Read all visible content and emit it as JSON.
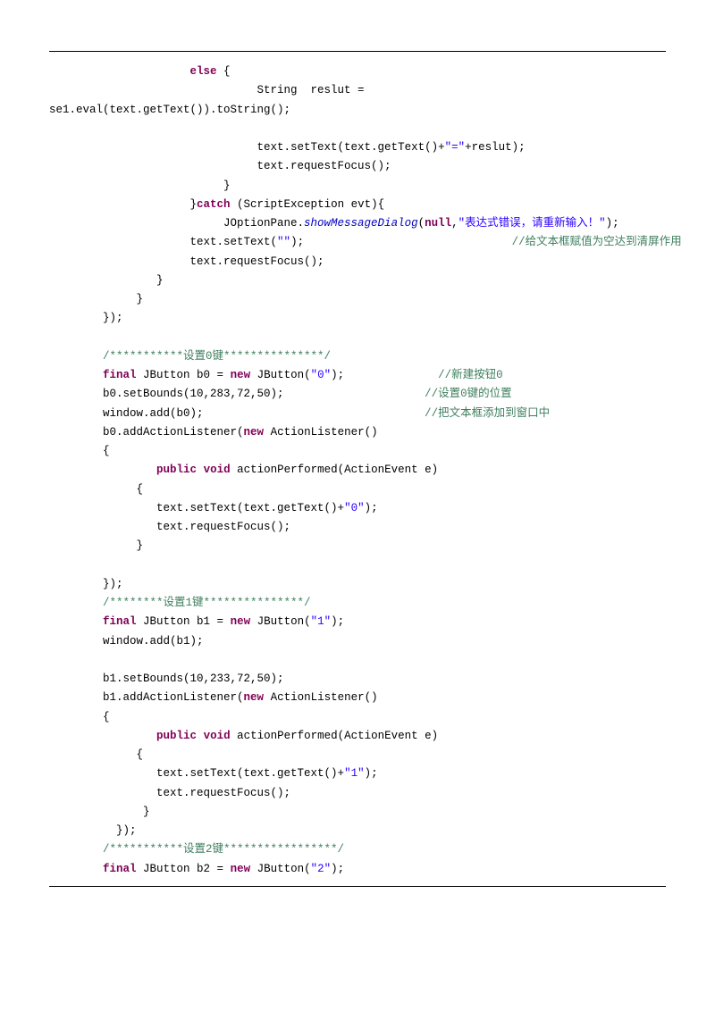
{
  "code": {
    "l01a": "else",
    "l01b": " {",
    "l02a": "                               String  reslut = ",
    "l03a": "se1.eval(text.getText()).toString();",
    "l04a": "                               text.setText(text.getText()+",
    "l04b": "\"=\"",
    "l04c": "+reslut);",
    "l05a": "                               text.requestFocus();",
    "l06a": "                          }",
    "l07a": "                     }",
    "l07b": "catch",
    "l07c": " (ScriptException evt){",
    "l08a": "                          JOptionPane.",
    "l08b": "showMessageDialog",
    "l08c": "(",
    "l08d": "null",
    "l08e": ",",
    "l08f": "\"表达式错误，请重新输入！\"",
    "l08g": ");",
    "l09a": "                     text.setText(",
    "l09b": "\"\"",
    "l09c": ");                               ",
    "l09d": "//给文本框赋值为空达到清屏作用",
    "l10a": "                     text.requestFocus();",
    "l11a": "                }",
    "l12a": "             }",
    "l13a": "        });",
    "l14a": "        ",
    "l14b": "/***********设置0键***************/",
    "l15a": "        ",
    "l15b": "final",
    "l15c": " JButton b0 = ",
    "l15d": "new",
    "l15e": " JButton(",
    "l15f": "\"0\"",
    "l15g": ");              ",
    "l15h": "//新建按钮0",
    "l16a": "        b0.setBounds(10,283,72,50);                     ",
    "l16b": "//设置0键的位置",
    "l17a": "        window.add(b0);                                 ",
    "l17b": "//把文本框添加到窗口中",
    "l18a": "        b0.addActionListener(",
    "l18b": "new",
    "l18c": " ActionListener()",
    "l19a": "        {",
    "l20a": "                ",
    "l20b": "public",
    "l20c": " ",
    "l20d": "void",
    "l20e": " actionPerformed(ActionEvent e)",
    "l21a": "             {",
    "l22a": "                text.setText(text.getText()+",
    "l22b": "\"0\"",
    "l22c": ");",
    "l23a": "                text.requestFocus();",
    "l24a": "             }",
    "l25a": "        });",
    "l26a": "        ",
    "l26b": "/********设置1键***************/",
    "l27a": "        ",
    "l27b": "final",
    "l27c": " JButton b1 = ",
    "l27d": "new",
    "l27e": " JButton(",
    "l27f": "\"1\"",
    "l27g": ");",
    "l28a": "        window.add(b1);",
    "l29a": "        b1.setBounds(10,233,72,50);",
    "l30a": "        b1.addActionListener(",
    "l30b": "new",
    "l30c": " ActionListener()",
    "l31a": "        {",
    "l32a": "                ",
    "l32b": "public",
    "l32c": " ",
    "l32d": "void",
    "l32e": " actionPerformed(ActionEvent e)",
    "l33a": "             {",
    "l34a": "                text.setText(text.getText()+",
    "l34b": "\"1\"",
    "l34c": ");",
    "l35a": "                text.requestFocus();",
    "l36a": "              }",
    "l37a": "          });",
    "l38a": "        ",
    "l38b": "/***********设置2键*****************/",
    "l39a": "        ",
    "l39b": "final",
    "l39c": " JButton b2 = ",
    "l39d": "new",
    "l39e": " JButton(",
    "l39f": "\"2\"",
    "l39g": ");"
  }
}
